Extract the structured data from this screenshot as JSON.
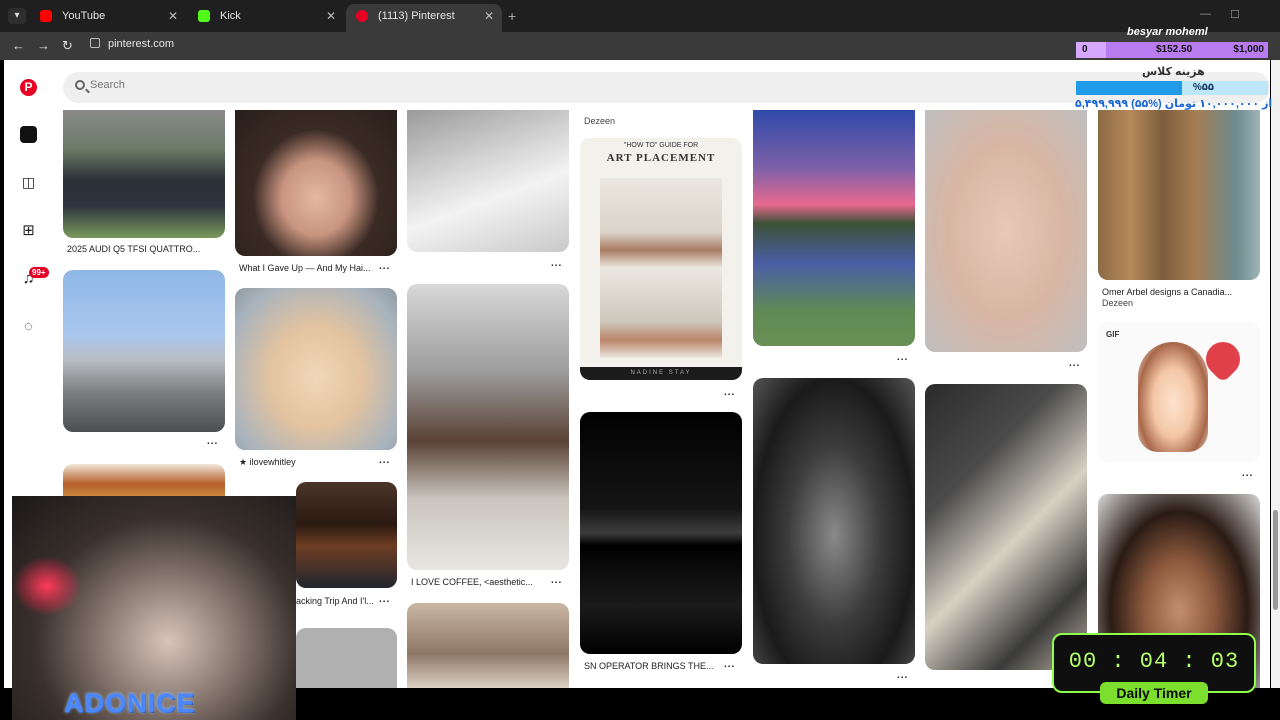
{
  "browser": {
    "tabs": [
      {
        "label": "YouTube",
        "color": "#ff0000"
      },
      {
        "label": "Kick",
        "color": "#53fc18"
      },
      {
        "label": "(1113) Pinterest",
        "color": "#e60023"
      }
    ],
    "url": "pinterest.com"
  },
  "sidebar": {
    "notification_badge": "99+"
  },
  "search": {
    "placeholder": "Search"
  },
  "pins": {
    "audi": {
      "caption": "2025 AUDI Q5 TFSI QUATTRO..."
    },
    "girl1": {
      "caption": "What I Gave Up — And My Hai..."
    },
    "nails_user": {
      "caption": "★ ilovewhitley"
    },
    "coffee": {
      "caption": "I LOVE COFFEE, <aesthetic..."
    },
    "cake2": {
      "caption": "acking Trip And I'l..."
    },
    "dezeen_top": {
      "caption": "Dezeen"
    },
    "guide": {
      "title_small": "\"HOW TO\" GUIDE FOR",
      "title": "ART PLACEMENT",
      "footer": "NADINE STAY"
    },
    "snes": {
      "caption": "SN OPERATOR BRINGS THE..."
    },
    "omer": {
      "caption": "Omer Arbel designs a Canadia...",
      "source": "Dezeen"
    },
    "gif": {
      "label": "GIF"
    }
  },
  "overlay": {
    "streamer_name": "besyar moheml",
    "goal_start": "0",
    "goal_current": "$152.50",
    "goal_target": "$1,000",
    "fund_label": "هزینه کلاس",
    "fund_percent": "%۵۵",
    "fund_total": "۵,۴۹۹,۹۹۹ از ۱۰,۰۰۰,۰۰۰ تومان (%۵۵)",
    "brand": "ADONICE",
    "timer": "00 : 04 : 03",
    "timer_label": "Daily Timer"
  },
  "dots": "..."
}
